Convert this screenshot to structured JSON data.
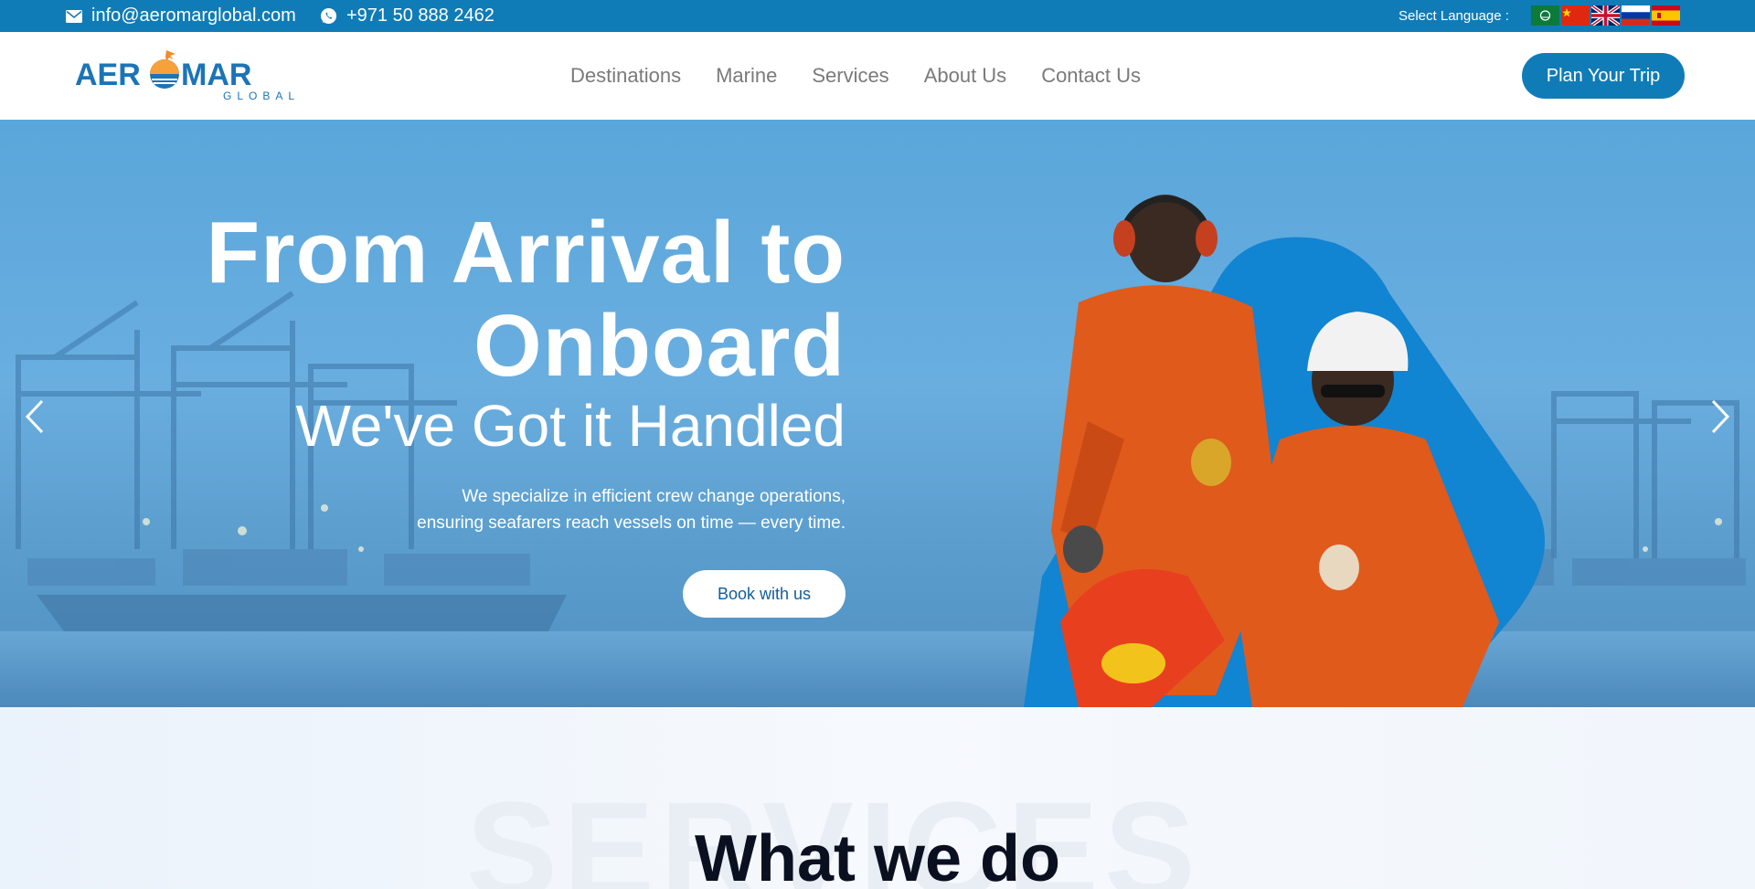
{
  "topbar": {
    "email": "info@aeromarglobal.com",
    "phone": "+971 50 888 2462",
    "language_label": "Select Language :",
    "languages": [
      "Arabic",
      "Chinese",
      "English",
      "Russian",
      "Spanish"
    ]
  },
  "header": {
    "logo_main": "AEROMAR",
    "logo_sub": "GLOBAL",
    "nav": [
      "Destinations",
      "Marine",
      "Services",
      "About Us",
      "Contact Us"
    ],
    "cta": "Plan Your Trip"
  },
  "hero": {
    "title_line1": "From Arrival to",
    "title_line2": "Onboard",
    "subtitle": "We've Got it Handled",
    "desc_line1": "We specialize in efficient crew change operations,",
    "desc_line2": "ensuring seafarers reach vessels on time — every time.",
    "button": "Book with us"
  },
  "services": {
    "background_word": "SERVICES",
    "title": "What we do"
  },
  "colors": {
    "brand_blue": "#0f7cb8",
    "accent_orange": "#f28c28"
  }
}
